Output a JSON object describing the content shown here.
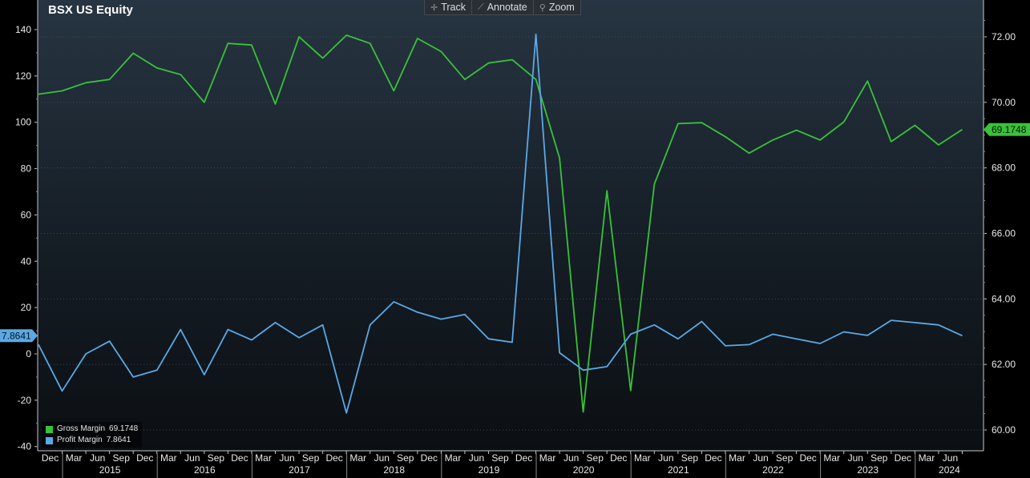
{
  "header": {
    "title": "BSX US Equity"
  },
  "toolbar": {
    "buttons": [
      {
        "label": "Track",
        "icon": "crosshair-icon"
      },
      {
        "label": "Annotate",
        "icon": "pencil-icon"
      },
      {
        "label": "Zoom",
        "icon": "magnifier-icon"
      }
    ]
  },
  "legend": {
    "items": [
      {
        "name": "Gross Margin",
        "value": "69.1748",
        "color": "#39c23a"
      },
      {
        "name": "Profit Margin",
        "value": "7.8641",
        "color": "#5aa9e6"
      }
    ]
  },
  "chart_data": {
    "type": "line",
    "left_axis": {
      "ticks": [
        140,
        120,
        100,
        80,
        60,
        40,
        20,
        0,
        -20,
        -40
      ],
      "ylim": [
        -40,
        140
      ],
      "series": "Profit Margin"
    },
    "right_axis": {
      "ticks": [
        "72.00",
        "70.00",
        "68.00",
        "66.00",
        "64.00",
        "62.00",
        "60.00"
      ],
      "ylim": [
        60,
        72
      ],
      "series": "Gross Margin"
    },
    "x_month_labels": [
      "Dec",
      "Mar",
      "Jun",
      "Sep",
      "Dec",
      "Mar",
      "Jun",
      "Sep",
      "Dec",
      "Mar",
      "Jun",
      "Sep",
      "Dec",
      "Mar",
      "Jun",
      "Sep",
      "Dec",
      "Mar",
      "Jun",
      "Sep",
      "Dec",
      "Mar",
      "Jun",
      "Sep",
      "Dec",
      "Mar",
      "Jun",
      "Sep",
      "Dec",
      "Mar",
      "Jun",
      "Sep",
      "Dec",
      "Mar",
      "Jun",
      "Sep",
      "Dec",
      "Mar",
      "Jun"
    ],
    "x_year_labels": [
      {
        "year": "2015",
        "start": 0,
        "end": 4
      },
      {
        "year": "2016",
        "start": 4,
        "end": 8
      },
      {
        "year": "2017",
        "start": 8,
        "end": 12
      },
      {
        "year": "2018",
        "start": 12,
        "end": 16
      },
      {
        "year": "2019",
        "start": 16,
        "end": 20
      },
      {
        "year": "2020",
        "start": 20,
        "end": 24
      },
      {
        "year": "2021",
        "start": 24,
        "end": 28
      },
      {
        "year": "2022",
        "start": 28,
        "end": 32
      },
      {
        "year": "2023",
        "start": 32,
        "end": 36
      },
      {
        "year": "2024",
        "start": 36,
        "end": 39
      }
    ],
    "series": [
      {
        "name": "Gross Margin",
        "axis": "right",
        "color": "#39c23a",
        "last_value": "69.1748",
        "values": [
          70.25,
          70.35,
          70.6,
          70.7,
          71.5,
          71.05,
          70.85,
          70.0,
          71.8,
          71.75,
          69.95,
          72.0,
          71.35,
          72.05,
          71.8,
          70.35,
          71.95,
          71.55,
          70.7,
          71.2,
          71.3,
          70.7,
          68.3,
          60.55,
          67.3,
          61.2,
          67.5,
          69.35,
          69.38,
          68.95,
          68.45,
          68.85,
          69.15,
          68.85,
          69.4,
          70.65,
          68.8,
          69.3,
          68.7,
          69.17
        ]
      },
      {
        "name": "Profit Margin",
        "axis": "left",
        "color": "#5aa9e6",
        "last_value": "7.8641",
        "values": [
          4.0,
          -16.0,
          0.0,
          5.5,
          -10.0,
          -7.0,
          10.5,
          -9.0,
          10.5,
          6.0,
          13.5,
          7.0,
          12.5,
          -25.5,
          12.5,
          22.5,
          18.0,
          15.0,
          17.0,
          6.5,
          5.0,
          138.0,
          0.5,
          -7.0,
          -5.5,
          8.5,
          12.5,
          6.5,
          14.0,
          3.5,
          4.0,
          8.5,
          6.5,
          4.5,
          9.5,
          8.0,
          14.5,
          13.5,
          12.5,
          7.86
        ]
      }
    ],
    "grid": true,
    "legend_position": "bottom-left"
  }
}
